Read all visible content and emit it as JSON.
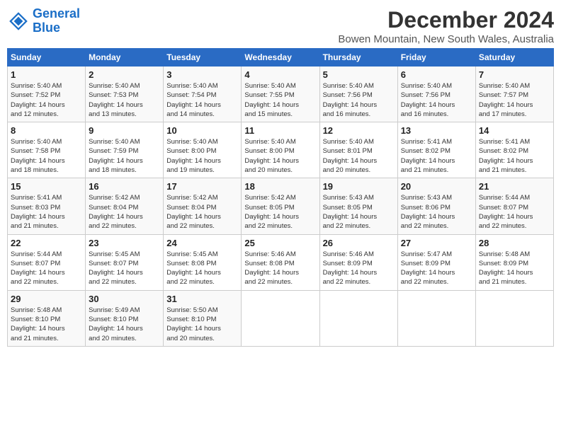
{
  "header": {
    "logo_line1": "General",
    "logo_line2": "Blue",
    "title": "December 2024",
    "subtitle": "Bowen Mountain, New South Wales, Australia"
  },
  "days_of_week": [
    "Sunday",
    "Monday",
    "Tuesday",
    "Wednesday",
    "Thursday",
    "Friday",
    "Saturday"
  ],
  "weeks": [
    [
      {
        "day": "1",
        "sunrise": "5:40 AM",
        "sunset": "7:52 PM",
        "daylight": "14 hours and 12 minutes."
      },
      {
        "day": "2",
        "sunrise": "5:40 AM",
        "sunset": "7:53 PM",
        "daylight": "14 hours and 13 minutes."
      },
      {
        "day": "3",
        "sunrise": "5:40 AM",
        "sunset": "7:54 PM",
        "daylight": "14 hours and 14 minutes."
      },
      {
        "day": "4",
        "sunrise": "5:40 AM",
        "sunset": "7:55 PM",
        "daylight": "14 hours and 15 minutes."
      },
      {
        "day": "5",
        "sunrise": "5:40 AM",
        "sunset": "7:56 PM",
        "daylight": "14 hours and 16 minutes."
      },
      {
        "day": "6",
        "sunrise": "5:40 AM",
        "sunset": "7:56 PM",
        "daylight": "14 hours and 16 minutes."
      },
      {
        "day": "7",
        "sunrise": "5:40 AM",
        "sunset": "7:57 PM",
        "daylight": "14 hours and 17 minutes."
      }
    ],
    [
      {
        "day": "8",
        "sunrise": "5:40 AM",
        "sunset": "7:58 PM",
        "daylight": "14 hours and 18 minutes."
      },
      {
        "day": "9",
        "sunrise": "5:40 AM",
        "sunset": "7:59 PM",
        "daylight": "14 hours and 18 minutes."
      },
      {
        "day": "10",
        "sunrise": "5:40 AM",
        "sunset": "8:00 PM",
        "daylight": "14 hours and 19 minutes."
      },
      {
        "day": "11",
        "sunrise": "5:40 AM",
        "sunset": "8:00 PM",
        "daylight": "14 hours and 20 minutes."
      },
      {
        "day": "12",
        "sunrise": "5:40 AM",
        "sunset": "8:01 PM",
        "daylight": "14 hours and 20 minutes."
      },
      {
        "day": "13",
        "sunrise": "5:41 AM",
        "sunset": "8:02 PM",
        "daylight": "14 hours and 21 minutes."
      },
      {
        "day": "14",
        "sunrise": "5:41 AM",
        "sunset": "8:02 PM",
        "daylight": "14 hours and 21 minutes."
      }
    ],
    [
      {
        "day": "15",
        "sunrise": "5:41 AM",
        "sunset": "8:03 PM",
        "daylight": "14 hours and 21 minutes."
      },
      {
        "day": "16",
        "sunrise": "5:42 AM",
        "sunset": "8:04 PM",
        "daylight": "14 hours and 22 minutes."
      },
      {
        "day": "17",
        "sunrise": "5:42 AM",
        "sunset": "8:04 PM",
        "daylight": "14 hours and 22 minutes."
      },
      {
        "day": "18",
        "sunrise": "5:42 AM",
        "sunset": "8:05 PM",
        "daylight": "14 hours and 22 minutes."
      },
      {
        "day": "19",
        "sunrise": "5:43 AM",
        "sunset": "8:05 PM",
        "daylight": "14 hours and 22 minutes."
      },
      {
        "day": "20",
        "sunrise": "5:43 AM",
        "sunset": "8:06 PM",
        "daylight": "14 hours and 22 minutes."
      },
      {
        "day": "21",
        "sunrise": "5:44 AM",
        "sunset": "8:07 PM",
        "daylight": "14 hours and 22 minutes."
      }
    ],
    [
      {
        "day": "22",
        "sunrise": "5:44 AM",
        "sunset": "8:07 PM",
        "daylight": "14 hours and 22 minutes."
      },
      {
        "day": "23",
        "sunrise": "5:45 AM",
        "sunset": "8:07 PM",
        "daylight": "14 hours and 22 minutes."
      },
      {
        "day": "24",
        "sunrise": "5:45 AM",
        "sunset": "8:08 PM",
        "daylight": "14 hours and 22 minutes."
      },
      {
        "day": "25",
        "sunrise": "5:46 AM",
        "sunset": "8:08 PM",
        "daylight": "14 hours and 22 minutes."
      },
      {
        "day": "26",
        "sunrise": "5:46 AM",
        "sunset": "8:09 PM",
        "daylight": "14 hours and 22 minutes."
      },
      {
        "day": "27",
        "sunrise": "5:47 AM",
        "sunset": "8:09 PM",
        "daylight": "14 hours and 22 minutes."
      },
      {
        "day": "28",
        "sunrise": "5:48 AM",
        "sunset": "8:09 PM",
        "daylight": "14 hours and 21 minutes."
      }
    ],
    [
      {
        "day": "29",
        "sunrise": "5:48 AM",
        "sunset": "8:10 PM",
        "daylight": "14 hours and 21 minutes."
      },
      {
        "day": "30",
        "sunrise": "5:49 AM",
        "sunset": "8:10 PM",
        "daylight": "14 hours and 20 minutes."
      },
      {
        "day": "31",
        "sunrise": "5:50 AM",
        "sunset": "8:10 PM",
        "daylight": "14 hours and 20 minutes."
      },
      null,
      null,
      null,
      null
    ]
  ]
}
